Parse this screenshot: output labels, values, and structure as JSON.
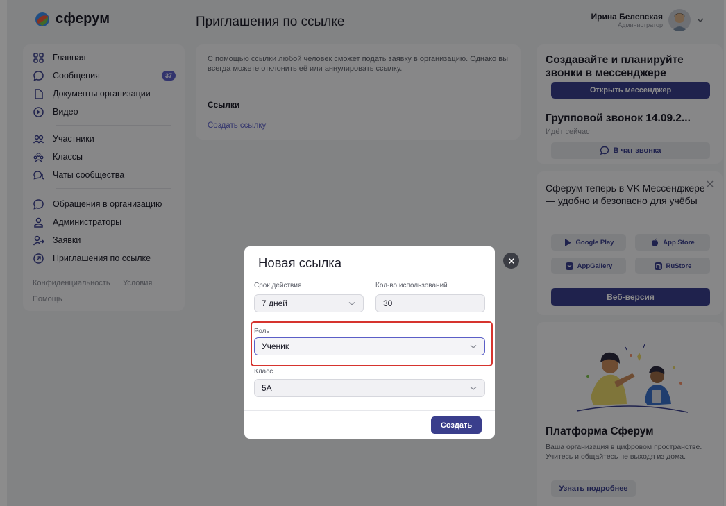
{
  "header": {
    "logo_text": "сферум",
    "page_title": "Приглашения по ссылке",
    "user_name": "Ирина Белевская",
    "user_role": "Администратор"
  },
  "sidebar": {
    "items": [
      {
        "label": "Главная",
        "icon": "grid-icon"
      },
      {
        "label": "Сообщения",
        "icon": "chat-icon",
        "badge": "37"
      },
      {
        "label": "Документы организации",
        "icon": "document-icon"
      },
      {
        "label": "Видео",
        "icon": "play-icon"
      },
      {
        "label": "Участники",
        "icon": "users-icon"
      },
      {
        "label": "Классы",
        "icon": "classes-icon"
      },
      {
        "label": "Чаты сообщества",
        "icon": "community-chat-icon"
      },
      {
        "label": "Обращения в организацию",
        "icon": "appeal-icon"
      },
      {
        "label": "Администраторы",
        "icon": "admin-icon"
      },
      {
        "label": "Заявки",
        "icon": "requests-icon"
      },
      {
        "label": "Приглашения по ссылке",
        "icon": "link-invite-icon"
      }
    ],
    "footer_privacy": "Конфиденциальность",
    "footer_terms": "Условия",
    "footer_help": "Помощь"
  },
  "main": {
    "info_text": "С помощью ссылки любой человек сможет подать заявку в организацию. Однако вы всегда можете отклонить её или аннулировать ссылку.",
    "links_label": "Ссылки",
    "create_link": "Создать ссылку"
  },
  "right": {
    "card1_title": "Создавайте и планируйте звонки в мессенджере",
    "open_messenger": "Открыть мессенджер",
    "call_title": "Групповой звонок 14.09.2...",
    "call_status": "Идёт сейчас",
    "to_call_chat": "В чат звонка",
    "card2_text": "Сферум теперь в VK Мессенджере — удобно и безопасно для учёбы",
    "google_play": "Google Play",
    "app_store": "App Store",
    "app_gallery": "AppGallery",
    "rustore": "RuStore",
    "web_version": "Веб-версия",
    "platform_title": "Платформа Сферум",
    "platform_text": "Ваша организация в цифровом пространстве. Учитесь и общайтесь не выходя из дома.",
    "learn_more": "Узнать подробнее"
  },
  "modal": {
    "title": "Новая ссылка",
    "validity_label": "Срок действия",
    "validity_value": "7 дней",
    "uses_label": "Кол-во использований",
    "uses_value": "30",
    "role_label": "Роль",
    "role_value": "Ученик",
    "class_label": "Класс",
    "class_value": "5А",
    "create_button": "Создать"
  },
  "colors": {
    "accent": "#3a3e8c",
    "link": "#5b5fc7",
    "highlight": "#d6342e"
  }
}
